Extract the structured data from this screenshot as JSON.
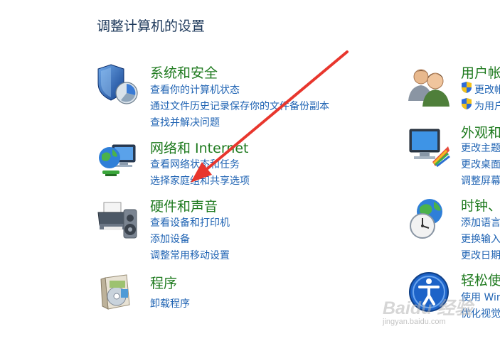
{
  "page_title": "调整计算机的设置",
  "left_column": [
    {
      "title": "系统和安全",
      "icon": "security-shield-icon",
      "links": [
        "查看你的计算机状态",
        "通过文件历史记录保存你的文件备份副本",
        "查找并解决问题"
      ]
    },
    {
      "title": "网络和 Internet",
      "icon": "network-globe-icon",
      "links": [
        "查看网络状态和任务",
        "选择家庭组和共享选项"
      ]
    },
    {
      "title": "硬件和声音",
      "icon": "printer-speaker-icon",
      "links": [
        "查看设备和打印机",
        "添加设备",
        "调整常用移动设置"
      ]
    },
    {
      "title": "程序",
      "icon": "programs-box-icon",
      "links": [
        "卸载程序"
      ]
    }
  ],
  "right_column": [
    {
      "title": "用户帐",
      "icon": "user-accounts-icon",
      "links": [
        "更改帐",
        "为用户"
      ]
    },
    {
      "title": "外观和",
      "icon": "appearance-monitor-icon",
      "links": [
        "更改主题",
        "更改桌面",
        "调整屏幕"
      ]
    },
    {
      "title": "时钟、",
      "icon": "clock-globe-icon",
      "links": [
        "添加语言",
        "更换输入",
        "更改日期"
      ]
    },
    {
      "title": "轻松使",
      "icon": "ease-of-access-icon",
      "links": [
        "使用 Win",
        "优化视觉"
      ]
    }
  ],
  "watermark": {
    "logo": "Baidu 经验",
    "url": "jingyan.baidu.com"
  },
  "annotation": {
    "arrow_color": "#e8362d"
  }
}
